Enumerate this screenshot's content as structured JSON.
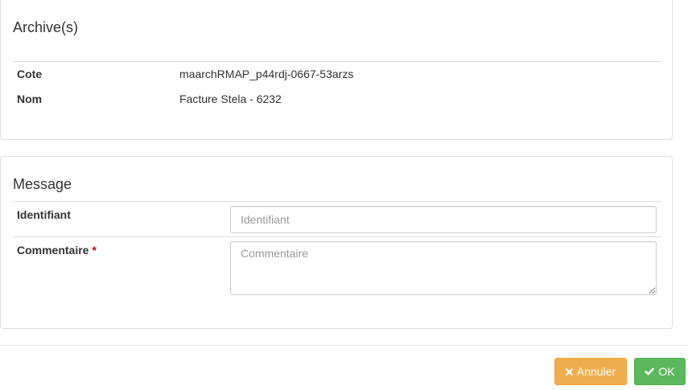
{
  "archives": {
    "title": "Archive(s)",
    "rows": [
      {
        "label": "Cote",
        "value": "maarchRMAP_p44rdj-0667-53arzs"
      },
      {
        "label": "Nom",
        "value": "Facture Stela - 6232"
      }
    ]
  },
  "message": {
    "title": "Message",
    "identifiant": {
      "label": "Identifiant",
      "value": "",
      "placeholder": "Identifiant"
    },
    "commentaire": {
      "label": "Commentaire",
      "required_mark": "*",
      "value": "",
      "placeholder": "Commentaire"
    }
  },
  "footer": {
    "cancel_label": "Annuler",
    "ok_label": "OK"
  },
  "colors": {
    "cancel": "#f0ad4e",
    "ok": "#5cb85c",
    "required": "#cc0000"
  },
  "icons": {
    "cancel": "times-icon",
    "ok": "check-icon"
  }
}
